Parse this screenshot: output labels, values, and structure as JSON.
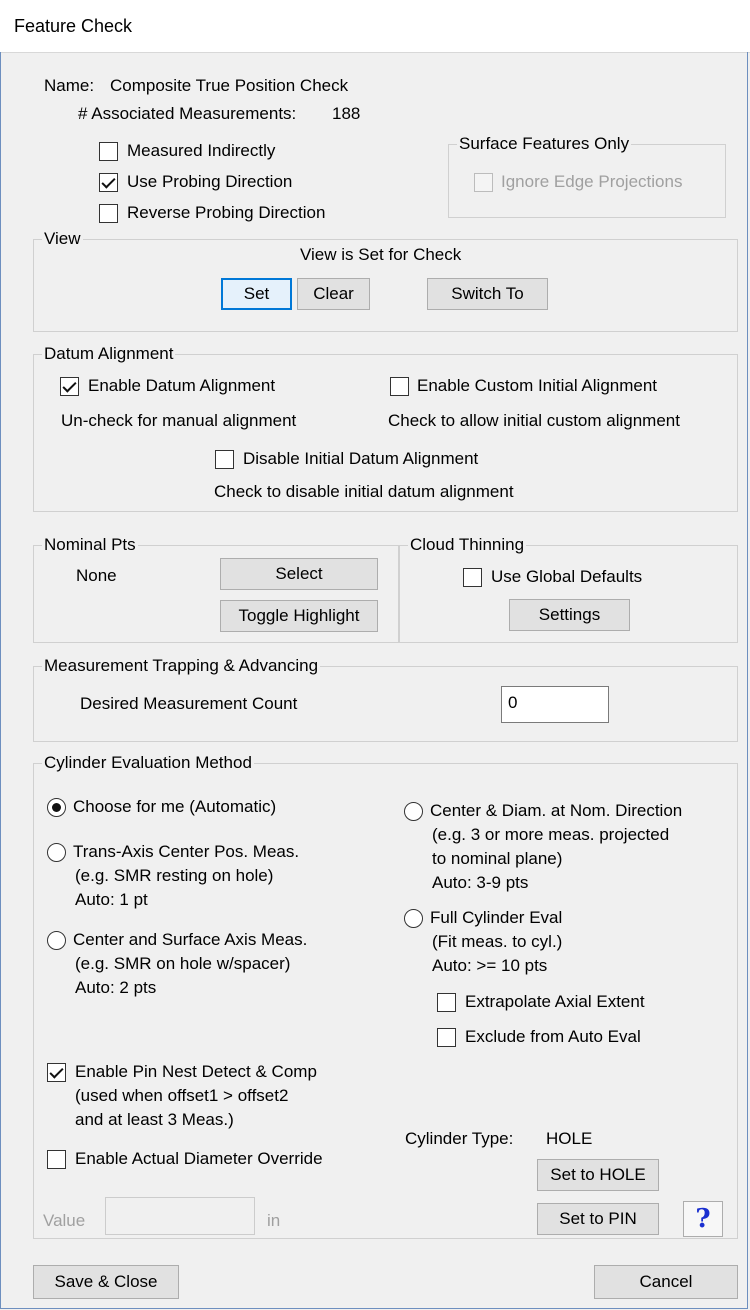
{
  "window": {
    "title": "Feature Check"
  },
  "header": {
    "name_label": "Name:",
    "name_value": "Composite True Position Check",
    "assoc_label": "# Associated Measurements:",
    "assoc_value": "188"
  },
  "options": {
    "measured_indirectly": {
      "label": "Measured Indirectly",
      "checked": false
    },
    "use_probing_direction": {
      "label": "Use Probing Direction",
      "checked": true
    },
    "reverse_probing_direction": {
      "label": "Reverse Probing Direction",
      "checked": false
    }
  },
  "surface_features": {
    "title": "Surface Features Only",
    "ignore_edge": {
      "label": "Ignore Edge Projections",
      "checked": false,
      "enabled": false
    }
  },
  "view": {
    "title": "View",
    "status": "View is Set for Check",
    "set_label": "Set",
    "clear_label": "Clear",
    "switch_label": "Switch To"
  },
  "datum": {
    "title": "Datum Alignment",
    "enable_datum": {
      "label": "Enable Datum Alignment",
      "checked": true,
      "hint": "Un-check for manual alignment"
    },
    "enable_custom": {
      "label": "Enable Custom Initial Alignment",
      "checked": false,
      "hint": "Check to allow initial custom alignment"
    },
    "disable_initial": {
      "label": "Disable Initial Datum Alignment",
      "checked": false,
      "hint": "Check to disable initial datum alignment"
    }
  },
  "nominal": {
    "title": "Nominal Pts",
    "value": "None",
    "select_label": "Select",
    "toggle_label": "Toggle Highlight"
  },
  "cloud": {
    "title": "Cloud Thinning",
    "use_global": {
      "label": "Use Global Defaults",
      "checked": false
    },
    "settings_label": "Settings"
  },
  "trapping": {
    "title": "Measurement Trapping & Advancing",
    "count_label": "Desired Measurement Count",
    "count_value": "0"
  },
  "cylinder": {
    "title": "Cylinder Evaluation Method",
    "methods": {
      "auto": {
        "label": "Choose for me (Automatic)",
        "selected": true
      },
      "trans_axis": {
        "label": "Trans-Axis Center Pos. Meas.",
        "l2": "(e.g. SMR resting on hole)",
        "l3": "Auto: 1 pt"
      },
      "center_surface": {
        "label": "Center and Surface Axis Meas.",
        "l2": "(e.g. SMR on hole w/spacer)",
        "l3": "Auto: 2 pts"
      },
      "center_diam": {
        "label": "Center & Diam. at Nom. Direction",
        "l2": "(e.g. 3 or more meas. projected",
        "l3": "to nominal plane)",
        "l4": "Auto: 3-9 pts"
      },
      "full_cyl": {
        "label": "Full Cylinder Eval",
        "l2": "(Fit meas. to cyl.)",
        "l3": "Auto: >= 10 pts"
      }
    },
    "extrapolate": {
      "label": "Extrapolate Axial Extent",
      "checked": false
    },
    "exclude_auto": {
      "label": "Exclude from Auto Eval",
      "checked": false
    },
    "pin_nest": {
      "label": "Enable Pin Nest Detect & Comp",
      "l2": "(used when offset1 > offset2",
      "l3": "and at least 3 Meas.)",
      "checked": true
    },
    "diam_override": {
      "label": "Enable Actual Diameter Override",
      "checked": false
    },
    "value_label": "Value",
    "value_unit": "in",
    "value_text": "",
    "type_label": "Cylinder Type:",
    "type_value": "HOLE",
    "set_hole_label": "Set to HOLE",
    "set_pin_label": "Set to PIN",
    "help_glyph": "?"
  },
  "footer": {
    "save_label": "Save & Close",
    "cancel_label": "Cancel"
  },
  "colors": {
    "focus_border": "#0078d7",
    "help": "#1a2fd0",
    "group_border": "#d0d0d0"
  }
}
